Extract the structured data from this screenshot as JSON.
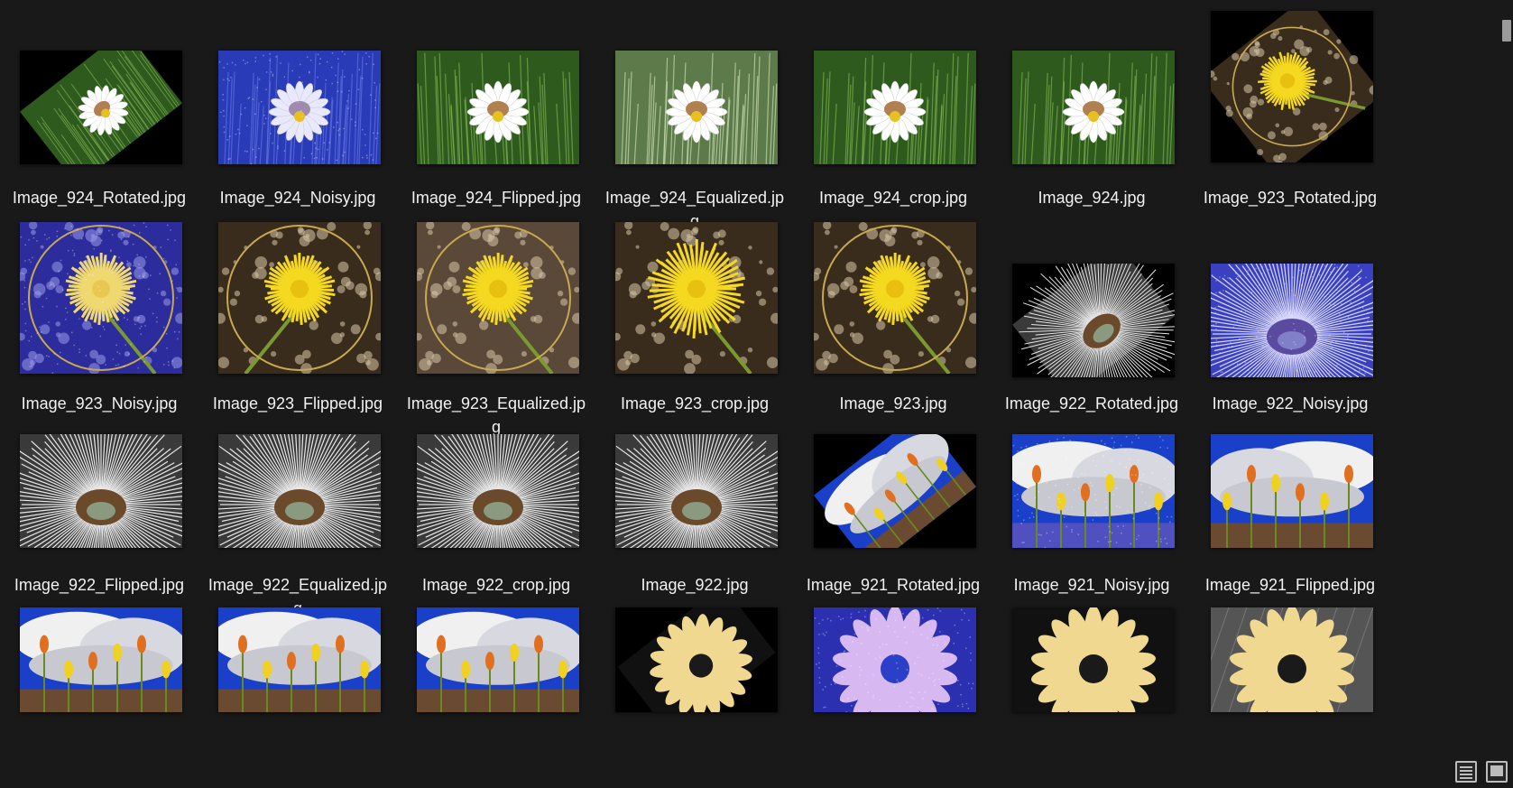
{
  "view_buttons": {
    "details_icon": "details-view-icon",
    "large_icon": "large-icons-view-icon"
  },
  "items": [
    {
      "name": "Image_924_Rotated.jpg",
      "scene": "daisy",
      "variant": "rotated"
    },
    {
      "name": "Image_924_Noisy.jpg",
      "scene": "daisy",
      "variant": "noisy"
    },
    {
      "name": "Image_924_Flipped.jpg",
      "scene": "daisy",
      "variant": "flipped"
    },
    {
      "name": "Image_924_Equalized.jpg",
      "scene": "daisy",
      "variant": "equalized"
    },
    {
      "name": "Image_924_crop.jpg",
      "scene": "daisy",
      "variant": "crop"
    },
    {
      "name": "Image_924.jpg",
      "scene": "daisy",
      "variant": "original"
    },
    {
      "name": "Image_923_Rotated.jpg",
      "scene": "dandelion",
      "variant": "rotated"
    },
    {
      "name": "Image_923_Noisy.jpg",
      "scene": "dandelion",
      "variant": "noisy"
    },
    {
      "name": "Image_923_Flipped.jpg",
      "scene": "dandelion",
      "variant": "flipped"
    },
    {
      "name": "Image_923_Equalized.jpg",
      "scene": "dandelion",
      "variant": "equalized"
    },
    {
      "name": "Image_923_crop.jpg",
      "scene": "dandelion",
      "variant": "crop"
    },
    {
      "name": "Image_923.jpg",
      "scene": "dandelion",
      "variant": "original"
    },
    {
      "name": "Image_922_Rotated.jpg",
      "scene": "seedhead",
      "variant": "rotated"
    },
    {
      "name": "Image_922_Noisy.jpg",
      "scene": "seedhead",
      "variant": "noisy"
    },
    {
      "name": "Image_922_Flipped.jpg",
      "scene": "seedhead",
      "variant": "flipped"
    },
    {
      "name": "Image_922_Equalized.jpg",
      "scene": "seedhead",
      "variant": "equalized"
    },
    {
      "name": "Image_922_crop.jpg",
      "scene": "seedhead",
      "variant": "crop"
    },
    {
      "name": "Image_922.jpg",
      "scene": "seedhead",
      "variant": "original"
    },
    {
      "name": "Image_921_Rotated.jpg",
      "scene": "sky",
      "variant": "rotated"
    },
    {
      "name": "Image_921_Noisy.jpg",
      "scene": "sky",
      "variant": "noisy"
    },
    {
      "name": "Image_921_Flipped.jpg",
      "scene": "sky",
      "variant": "flipped"
    },
    {
      "name": "",
      "scene": "sky",
      "variant": "original"
    },
    {
      "name": "",
      "scene": "sky",
      "variant": "crop"
    },
    {
      "name": "",
      "scene": "sky",
      "variant": "original"
    },
    {
      "name": "",
      "scene": "yellowdaisy",
      "variant": "rotated"
    },
    {
      "name": "",
      "scene": "yellowdaisy",
      "variant": "noisy"
    },
    {
      "name": "",
      "scene": "yellowdaisy",
      "variant": "crop"
    },
    {
      "name": "",
      "scene": "yellowdaisy",
      "variant": "gray"
    }
  ]
}
